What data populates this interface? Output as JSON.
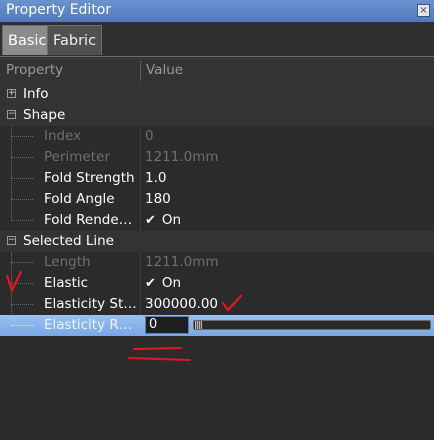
{
  "window": {
    "title": "Property Editor",
    "close_glyph": "×"
  },
  "tabs": [
    {
      "label": "Basic"
    },
    {
      "label": "Fabric"
    }
  ],
  "columns": {
    "property": "Property",
    "value": "Value"
  },
  "groups": {
    "info": {
      "label": "Info",
      "expand_glyph": "+"
    },
    "shape": {
      "label": "Shape",
      "expand_glyph": "−"
    },
    "selected_line": {
      "label": "Selected Line",
      "expand_glyph": "−"
    }
  },
  "shape_props": [
    {
      "name": "Index",
      "value": "0"
    },
    {
      "name": "Perimeter",
      "value": "1211.0mm"
    },
    {
      "name": "Fold Strength",
      "value": "1.0"
    },
    {
      "name": "Fold Angle",
      "value": "180"
    },
    {
      "name": "Fold Rende…",
      "value": "On",
      "check": "✔"
    }
  ],
  "line_props": [
    {
      "name": "Length",
      "value": "1211.0mm"
    },
    {
      "name": "Elastic",
      "value": "On",
      "check": "✔"
    },
    {
      "name": "Elasticity St…",
      "value": "300000.00"
    },
    {
      "name": "Elasticity R…",
      "value": "0"
    }
  ],
  "annotations": {
    "color": "#e8141e"
  }
}
